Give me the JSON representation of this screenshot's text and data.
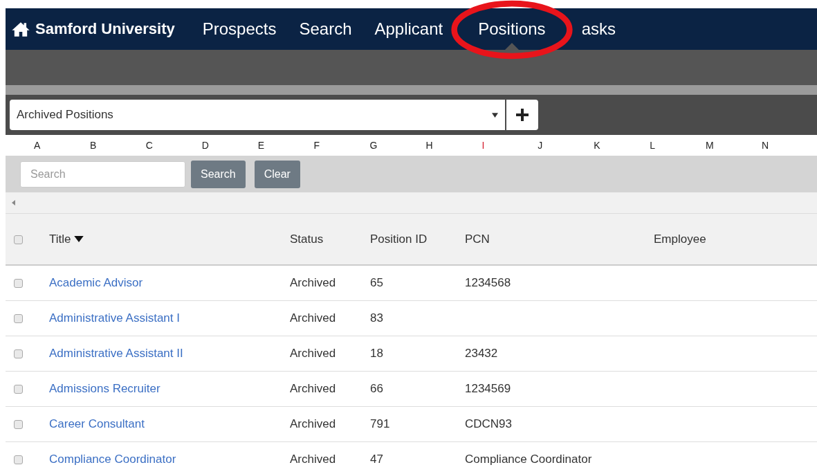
{
  "nav": {
    "brand": "Samford University",
    "items": [
      {
        "label": "Prospects",
        "selected": false
      },
      {
        "label": "Search",
        "selected": false
      },
      {
        "label": "Applicant",
        "selected": false
      },
      {
        "label": "Positions",
        "selected": true
      },
      {
        "label": "asks",
        "selected": false
      }
    ]
  },
  "view_select": {
    "value": "Archived Positions"
  },
  "letters": [
    {
      "label": "A",
      "selected": false
    },
    {
      "label": "B",
      "selected": false
    },
    {
      "label": "C",
      "selected": false
    },
    {
      "label": "D",
      "selected": false
    },
    {
      "label": "E",
      "selected": false
    },
    {
      "label": "F",
      "selected": false
    },
    {
      "label": "G",
      "selected": false
    },
    {
      "label": "H",
      "selected": false
    },
    {
      "label": "I",
      "selected": true
    },
    {
      "label": "J",
      "selected": false
    },
    {
      "label": "K",
      "selected": false
    },
    {
      "label": "L",
      "selected": false
    },
    {
      "label": "M",
      "selected": false
    },
    {
      "label": "N",
      "selected": false
    }
  ],
  "search": {
    "placeholder": "Search",
    "buttons": [
      "Search",
      "Clear"
    ]
  },
  "table": {
    "all_checked": false,
    "columns": [
      "Title",
      "Status",
      "Position ID",
      "PCN",
      "Employee"
    ],
    "rows": [
      {
        "checked": false,
        "cells": [
          "Academic Advisor",
          "Archived",
          "65",
          "1234568",
          ""
        ]
      },
      {
        "checked": false,
        "cells": [
          "Administrative Assistant I",
          "Archived",
          "83",
          "",
          ""
        ]
      },
      {
        "checked": false,
        "cells": [
          "Administrative Assistant II",
          "Archived",
          "18",
          "23432",
          ""
        ]
      },
      {
        "checked": false,
        "cells": [
          "Admissions Recruiter",
          "Archived",
          "66",
          "1234569",
          ""
        ]
      },
      {
        "checked": false,
        "cells": [
          "Career Consultant",
          "Archived",
          "791",
          "CDCN93",
          ""
        ]
      },
      {
        "checked": false,
        "cells": [
          "Compliance Coordinator",
          "Archived",
          "47",
          "Compliance Coordinator",
          ""
        ]
      }
    ]
  }
}
